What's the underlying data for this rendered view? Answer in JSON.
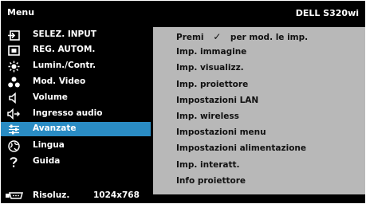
{
  "header": {
    "title": "Menu",
    "model": "DELL S320wi"
  },
  "left_menu": [
    {
      "label": "SELEZ. INPUT",
      "icon": "input-icon"
    },
    {
      "label": "REG. AUTOM.",
      "icon": "auto-adjust-icon"
    },
    {
      "label": "Lumin./Contr.",
      "icon": "brightness-icon"
    },
    {
      "label": "Mod. Video",
      "icon": "video-mode-icon"
    },
    {
      "label": "Volume",
      "icon": "volume-icon"
    },
    {
      "label": "Ingresso audio",
      "icon": "audio-input-icon"
    },
    {
      "label": "Avanzate",
      "icon": "advanced-settings-icon",
      "selected": true
    },
    {
      "label": "Lingua",
      "icon": "globe-icon"
    },
    {
      "label": "Guida",
      "icon": "help-icon"
    }
  ],
  "right_panel": {
    "hint_prefix": "Premi",
    "hint_suffix": "per mod. le imp.",
    "items": [
      "Imp. immagine",
      "Imp. visualizz.",
      "Imp. proiettore",
      "Impostazioni LAN",
      "Imp. wireless",
      "Impostazioni menu",
      "Impostazioni alimentazione",
      "Imp. interatt.",
      "Info proiettore"
    ]
  },
  "footer": {
    "label": "Risoluz.",
    "value": "1024x768"
  },
  "colors": {
    "background": "#000000",
    "highlight": "#2a8cc4",
    "panel": "#b8b8b8"
  }
}
